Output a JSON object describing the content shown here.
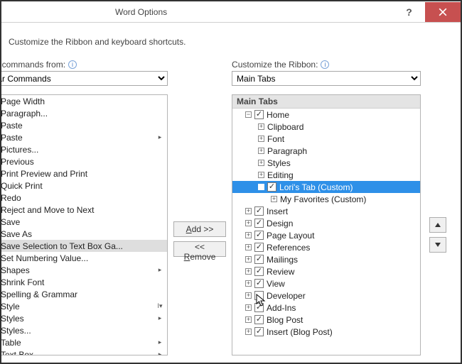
{
  "window": {
    "title": "Word Options"
  },
  "subtitle": "Customize the Ribbon and keyboard shortcuts.",
  "left": {
    "label_fragment": "ose commands from:",
    "combo_value_fragment": "ular Commands",
    "items": [
      {
        "label": "Page Width",
        "submenu": false
      },
      {
        "label": "Paragraph...",
        "submenu": false
      },
      {
        "label": "Paste",
        "submenu": false
      },
      {
        "label": "Paste",
        "submenu": true
      },
      {
        "label": "Pictures...",
        "submenu": false
      },
      {
        "label": "Previous",
        "submenu": false
      },
      {
        "label": "Print Preview and Print",
        "submenu": false
      },
      {
        "label": "Quick Print",
        "submenu": false
      },
      {
        "label": "Redo",
        "submenu": false
      },
      {
        "label": "Reject and Move to Next",
        "submenu": false
      },
      {
        "label": "Save",
        "submenu": false
      },
      {
        "label": "Save As",
        "submenu": false
      },
      {
        "label": "Save Selection to Text Box Ga...",
        "submenu": false,
        "selected": true
      },
      {
        "label": "Set Numbering Value...",
        "submenu": false
      },
      {
        "label": "Shapes",
        "submenu": true
      },
      {
        "label": "Shrink Font",
        "submenu": false
      },
      {
        "label": "Spelling & Grammar",
        "submenu": false
      },
      {
        "label": "Style",
        "submenu": true,
        "gallery": true
      },
      {
        "label": "Styles",
        "submenu": true
      },
      {
        "label": "Styles...",
        "submenu": false
      },
      {
        "label": "Table",
        "submenu": true
      },
      {
        "label": "Text Box",
        "submenu": true
      }
    ]
  },
  "buttons": {
    "add": "Add >>",
    "remove": "<< Remove"
  },
  "right": {
    "label": "Customize the Ribbon:",
    "combo_value": "Main Tabs",
    "header": "Main Tabs",
    "nodes": [
      {
        "depth": 1,
        "expando": "-",
        "check": true,
        "label": "Home"
      },
      {
        "depth": 2,
        "expando": "+",
        "label": "Clipboard"
      },
      {
        "depth": 2,
        "expando": "+",
        "label": "Font"
      },
      {
        "depth": 2,
        "expando": "+",
        "label": "Paragraph"
      },
      {
        "depth": 2,
        "expando": "+",
        "label": "Styles"
      },
      {
        "depth": 2,
        "expando": "+",
        "label": "Editing"
      },
      {
        "depth": 2,
        "expando": "-",
        "check": true,
        "label": "Lori's Tab (Custom)",
        "selected": true
      },
      {
        "depth": 3,
        "expando": "+",
        "label": "My Favorites (Custom)"
      },
      {
        "depth": 1,
        "expando": "+",
        "check": true,
        "label": "Insert"
      },
      {
        "depth": 1,
        "expando": "+",
        "check": true,
        "label": "Design"
      },
      {
        "depth": 1,
        "expando": "+",
        "check": true,
        "label": "Page Layout"
      },
      {
        "depth": 1,
        "expando": "+",
        "check": true,
        "label": "References"
      },
      {
        "depth": 1,
        "expando": "+",
        "check": true,
        "label": "Mailings"
      },
      {
        "depth": 1,
        "expando": "+",
        "check": true,
        "label": "Review"
      },
      {
        "depth": 1,
        "expando": "+",
        "check": true,
        "label": "View"
      },
      {
        "depth": 1,
        "expando": "+",
        "check": false,
        "label": "Developer"
      },
      {
        "depth": 1,
        "expando": "+",
        "check": true,
        "label": "Add-Ins"
      },
      {
        "depth": 1,
        "expando": "+",
        "check": true,
        "label": "Blog Post"
      },
      {
        "depth": 1,
        "expando": "+",
        "check": true,
        "label": "Insert (Blog Post)"
      }
    ]
  }
}
